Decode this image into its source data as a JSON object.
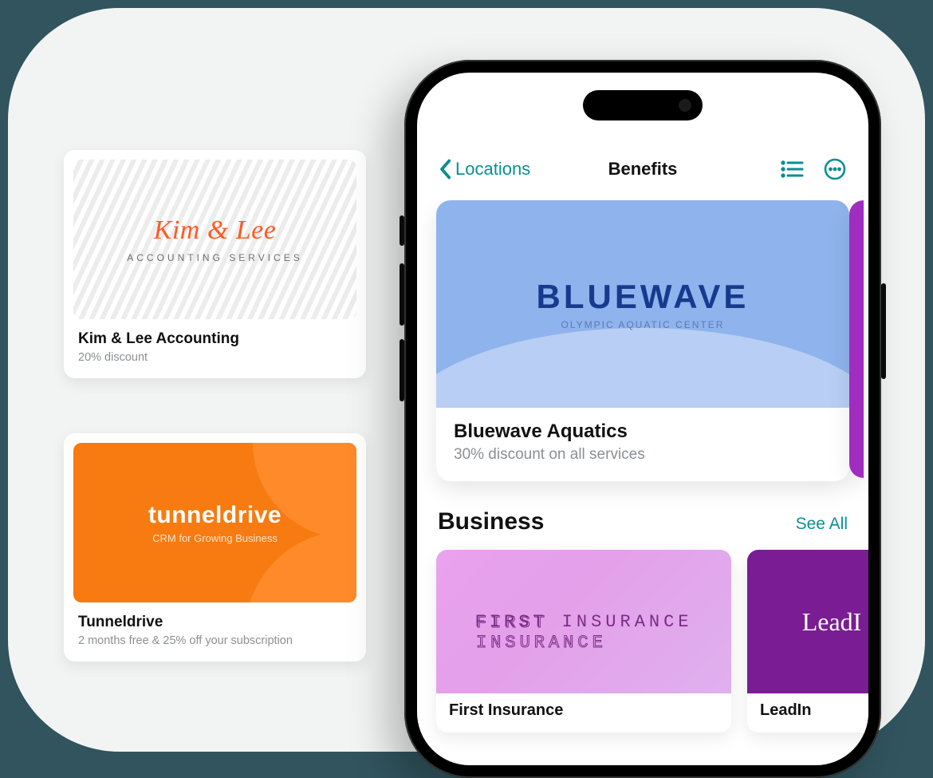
{
  "accent": "#0a8f93",
  "float_cards": [
    {
      "brand_line1": "Kim & Lee",
      "brand_line2": "ACCOUNTING SERVICES",
      "title": "Kim & Lee Accounting",
      "subtitle": "20% discount"
    },
    {
      "brand_line1": "tunneldrive",
      "brand_line2": "CRM for Growing Business",
      "title": "Tunneldrive",
      "subtitle": "2 months free & 25% off your subscription"
    }
  ],
  "phone": {
    "nav": {
      "back_label": "Locations",
      "title": "Benefits"
    },
    "hero": {
      "brand_line1": "BLUEWAVE",
      "brand_line2": "OLYMPIC AQUATIC CENTER",
      "title": "Bluewave Aquatics",
      "subtitle": "30% discount on all services"
    },
    "section": {
      "heading": "Business",
      "see_all": "See All",
      "items": [
        {
          "brand": "FIRST INSURANCE",
          "title": "First Insurance"
        },
        {
          "brand": "LeadI",
          "title": "LeadIn"
        }
      ]
    }
  }
}
